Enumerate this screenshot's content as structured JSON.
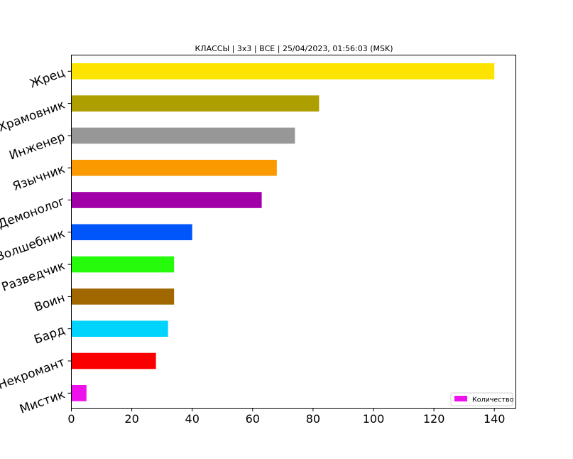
{
  "chart_data": {
    "type": "bar",
    "orientation": "horizontal",
    "title": "КЛАССЫ | 3x3 | ВСЕ | 25/04/2023, 01:56:03 (MSK)",
    "xlabel": "",
    "ylabel": "",
    "xlim": [
      0,
      147
    ],
    "xticks": [
      0,
      20,
      40,
      60,
      80,
      100,
      120,
      140
    ],
    "grid": false,
    "legend_position": "bottom-right",
    "legend_label": "Количество",
    "legend_color": "#ee11ee",
    "categories": [
      "Жрец",
      "Храмовник",
      "Инженер",
      "Язычник",
      "Демонолог",
      "Волшебник",
      "Разведчик",
      "Воин",
      "Бард",
      "Некромант",
      "Мистик"
    ],
    "values": [
      140,
      82,
      74,
      68,
      63,
      40,
      34,
      34,
      32,
      28,
      5
    ],
    "colors": [
      "#fce400",
      "#ae9f00",
      "#979797",
      "#fa9a00",
      "#a100a8",
      "#0056fb",
      "#25fb0b",
      "#a16800",
      "#00d3fc",
      "#fb0000",
      "#ee11ee"
    ]
  }
}
